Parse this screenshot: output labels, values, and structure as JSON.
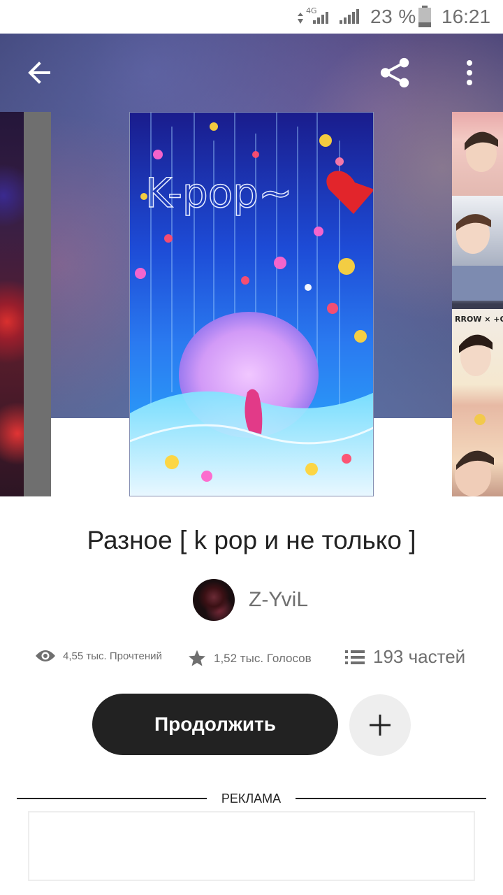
{
  "status_bar": {
    "network": "4G",
    "battery": "23 %",
    "time": "16:21"
  },
  "toolbar": {
    "back_icon": "arrow-left-icon",
    "share_icon": "share-icon",
    "more_icon": "more-vertical-icon"
  },
  "cover": {
    "text": "K-pop~"
  },
  "story": {
    "title": "Разное [ k pop и не только ]",
    "author": "Z-YviL",
    "reads": "4,55 тыс. Прочтений",
    "votes": "1,52 тыс. Голосов",
    "parts": "193 частей"
  },
  "actions": {
    "continue_label": "Продолжить"
  },
  "ad": {
    "label": "РЕКЛАМА"
  },
  "side_cover_tag": "RROW × +OG"
}
